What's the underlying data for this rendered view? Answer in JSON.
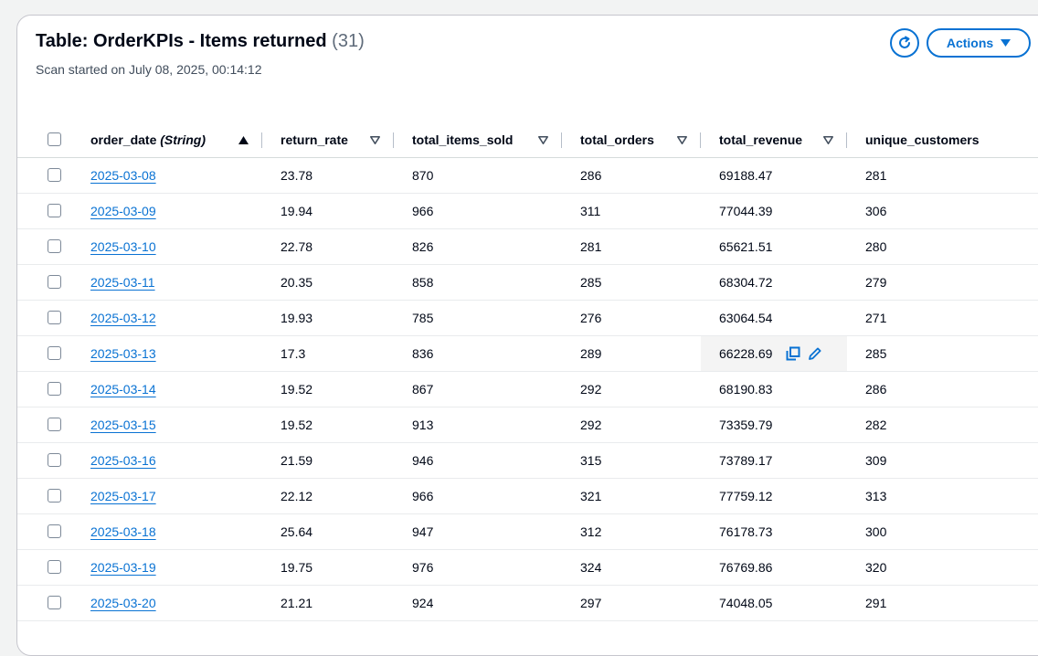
{
  "header": {
    "title": "Table: OrderKPIs - Items returned",
    "count": "(31)",
    "subtitle": "Scan started on July 08, 2025, 00:14:12",
    "actions_label": "Actions"
  },
  "table": {
    "columns": {
      "order_date_name": "order_date",
      "order_date_type": "(String)",
      "return_rate": "return_rate",
      "total_items_sold": "total_items_sold",
      "total_orders": "total_orders",
      "total_revenue": "total_revenue",
      "unique_customers": "unique_customers"
    },
    "rows": [
      {
        "order_date": "2025-03-08",
        "return_rate": "23.78",
        "total_items_sold": "870",
        "total_orders": "286",
        "total_revenue": "69188.47",
        "unique_customers": "281"
      },
      {
        "order_date": "2025-03-09",
        "return_rate": "19.94",
        "total_items_sold": "966",
        "total_orders": "311",
        "total_revenue": "77044.39",
        "unique_customers": "306"
      },
      {
        "order_date": "2025-03-10",
        "return_rate": "22.78",
        "total_items_sold": "826",
        "total_orders": "281",
        "total_revenue": "65621.51",
        "unique_customers": "280"
      },
      {
        "order_date": "2025-03-11",
        "return_rate": "20.35",
        "total_items_sold": "858",
        "total_orders": "285",
        "total_revenue": "68304.72",
        "unique_customers": "279"
      },
      {
        "order_date": "2025-03-12",
        "return_rate": "19.93",
        "total_items_sold": "785",
        "total_orders": "276",
        "total_revenue": "63064.54",
        "unique_customers": "271"
      },
      {
        "order_date": "2025-03-13",
        "return_rate": "17.3",
        "total_items_sold": "836",
        "total_orders": "289",
        "total_revenue": "66228.69",
        "unique_customers": "285"
      },
      {
        "order_date": "2025-03-14",
        "return_rate": "19.52",
        "total_items_sold": "867",
        "total_orders": "292",
        "total_revenue": "68190.83",
        "unique_customers": "286"
      },
      {
        "order_date": "2025-03-15",
        "return_rate": "19.52",
        "total_items_sold": "913",
        "total_orders": "292",
        "total_revenue": "73359.79",
        "unique_customers": "282"
      },
      {
        "order_date": "2025-03-16",
        "return_rate": "21.59",
        "total_items_sold": "946",
        "total_orders": "315",
        "total_revenue": "73789.17",
        "unique_customers": "309"
      },
      {
        "order_date": "2025-03-17",
        "return_rate": "22.12",
        "total_items_sold": "966",
        "total_orders": "321",
        "total_revenue": "77759.12",
        "unique_customers": "313"
      },
      {
        "order_date": "2025-03-18",
        "return_rate": "25.64",
        "total_items_sold": "947",
        "total_orders": "312",
        "total_revenue": "76178.73",
        "unique_customers": "300"
      },
      {
        "order_date": "2025-03-19",
        "return_rate": "19.75",
        "total_items_sold": "976",
        "total_orders": "324",
        "total_revenue": "76769.86",
        "unique_customers": "320"
      },
      {
        "order_date": "2025-03-20",
        "return_rate": "21.21",
        "total_items_sold": "924",
        "total_orders": "297",
        "total_revenue": "74048.05",
        "unique_customers": "291"
      }
    ],
    "hovered_cell": {
      "row": 5,
      "column": "total_revenue"
    }
  },
  "icons": {
    "refresh": "refresh-icon",
    "actions_caret": "caret-down-icon",
    "sort_asc": "sort-ascending-icon",
    "sort_none": "sort-descending-icon",
    "copy": "copy-icon",
    "edit": "edit-pencil-icon"
  },
  "colors": {
    "accent": "#0972d3",
    "border": "#c6c6cd",
    "background": "#f2f3f3",
    "hover_cell": "#f4f4f4"
  }
}
